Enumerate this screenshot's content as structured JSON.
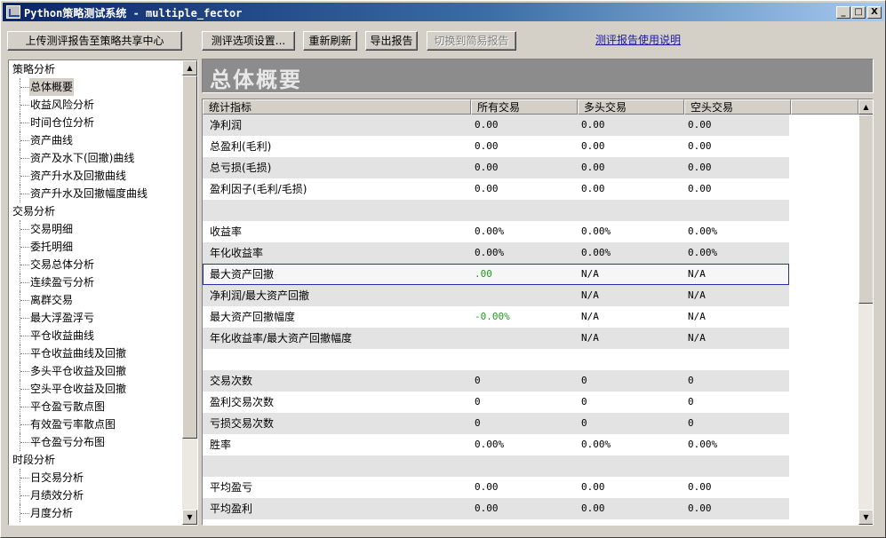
{
  "window": {
    "title": "Python策略测试系统 - multiple_fector",
    "min_label": "_",
    "max_label": "□",
    "close_label": "X"
  },
  "toolbar": {
    "upload_label": "上传测评报告至策略共享中心",
    "settings_label": "测评选项设置...",
    "refresh_label": "重新刷新",
    "export_label": "导出报告",
    "simple_label": "切换到简易报告",
    "help_link": "测评报告使用说明"
  },
  "sidebar": {
    "items": [
      {
        "label": "策略分析",
        "level": 0
      },
      {
        "label": "总体概要",
        "level": 1,
        "selected": true
      },
      {
        "label": "收益风险分析",
        "level": 1
      },
      {
        "label": "时间仓位分析",
        "level": 1
      },
      {
        "label": "资产曲线",
        "level": 1
      },
      {
        "label": "资产及水下(回撤)曲线",
        "level": 1
      },
      {
        "label": "资产升水及回撤曲线",
        "level": 1
      },
      {
        "label": "资产升水及回撤幅度曲线",
        "level": 1
      },
      {
        "label": "交易分析",
        "level": 0
      },
      {
        "label": "交易明细",
        "level": 1
      },
      {
        "label": "委托明细",
        "level": 1
      },
      {
        "label": "交易总体分析",
        "level": 1
      },
      {
        "label": "连续盈亏分析",
        "level": 1
      },
      {
        "label": "离群交易",
        "level": 1
      },
      {
        "label": "最大浮盈浮亏",
        "level": 1
      },
      {
        "label": "平仓收益曲线",
        "level": 1
      },
      {
        "label": "平仓收益曲线及回撤",
        "level": 1
      },
      {
        "label": "多头平仓收益及回撤",
        "level": 1
      },
      {
        "label": "空头平仓收益及回撤",
        "level": 1
      },
      {
        "label": "平仓盈亏散点图",
        "level": 1
      },
      {
        "label": "有效盈亏率散点图",
        "level": 1
      },
      {
        "label": "平仓盈亏分布图",
        "level": 1
      },
      {
        "label": "时段分析",
        "level": 0
      },
      {
        "label": "日交易分析",
        "level": 1
      },
      {
        "label": "月绩效分析",
        "level": 1
      },
      {
        "label": "月度分析",
        "level": 1
      }
    ]
  },
  "main": {
    "title": "总体概要",
    "columns": [
      "统计指标",
      "所有交易",
      "多头交易",
      "空头交易"
    ],
    "rows": [
      {
        "name": "净利润",
        "all": "0.00",
        "long": "0.00",
        "short": "0.00"
      },
      {
        "name": "总盈利(毛利)",
        "all": "0.00",
        "long": "0.00",
        "short": "0.00"
      },
      {
        "name": "总亏损(毛损)",
        "all": "0.00",
        "long": "0.00",
        "short": "0.00"
      },
      {
        "name": "盈利因子(毛利/毛损)",
        "all": "0.00",
        "long": "0.00",
        "short": "0.00"
      },
      {
        "name": "",
        "all": "",
        "long": "",
        "short": ""
      },
      {
        "name": "收益率",
        "all": "0.00%",
        "long": "0.00%",
        "short": "0.00%"
      },
      {
        "name": "年化收益率",
        "all": "0.00%",
        "long": "0.00%",
        "short": "0.00%"
      },
      {
        "name": "最大资产回撤",
        "all": ".00",
        "long": "N/A",
        "short": "N/A",
        "all_green": true,
        "highlight": true
      },
      {
        "name": "净利润/最大资产回撤",
        "all": "",
        "long": "N/A",
        "short": "N/A"
      },
      {
        "name": "最大资产回撤幅度",
        "all": "-0.00%",
        "long": "N/A",
        "short": "N/A",
        "all_green": true
      },
      {
        "name": "年化收益率/最大资产回撤幅度",
        "all": "",
        "long": "N/A",
        "short": "N/A"
      },
      {
        "name": "",
        "all": "",
        "long": "",
        "short": ""
      },
      {
        "name": "交易次数",
        "all": "0",
        "long": "0",
        "short": "0"
      },
      {
        "name": "盈利交易次数",
        "all": "0",
        "long": "0",
        "short": "0"
      },
      {
        "name": "亏损交易次数",
        "all": "0",
        "long": "0",
        "short": "0"
      },
      {
        "name": "胜率",
        "all": "0.00%",
        "long": "0.00%",
        "short": "0.00%"
      },
      {
        "name": "",
        "all": "",
        "long": "",
        "short": ""
      },
      {
        "name": "平均盈亏",
        "all": "0.00",
        "long": "0.00",
        "short": "0.00"
      },
      {
        "name": "平均盈利",
        "all": "0.00",
        "long": "0.00",
        "short": "0.00"
      },
      {
        "name": "",
        "all": "",
        "long": "",
        "short": ""
      }
    ]
  },
  "icons": {
    "app": "chart-app-icon",
    "scroll_up": "▲",
    "scroll_down": "▼"
  }
}
